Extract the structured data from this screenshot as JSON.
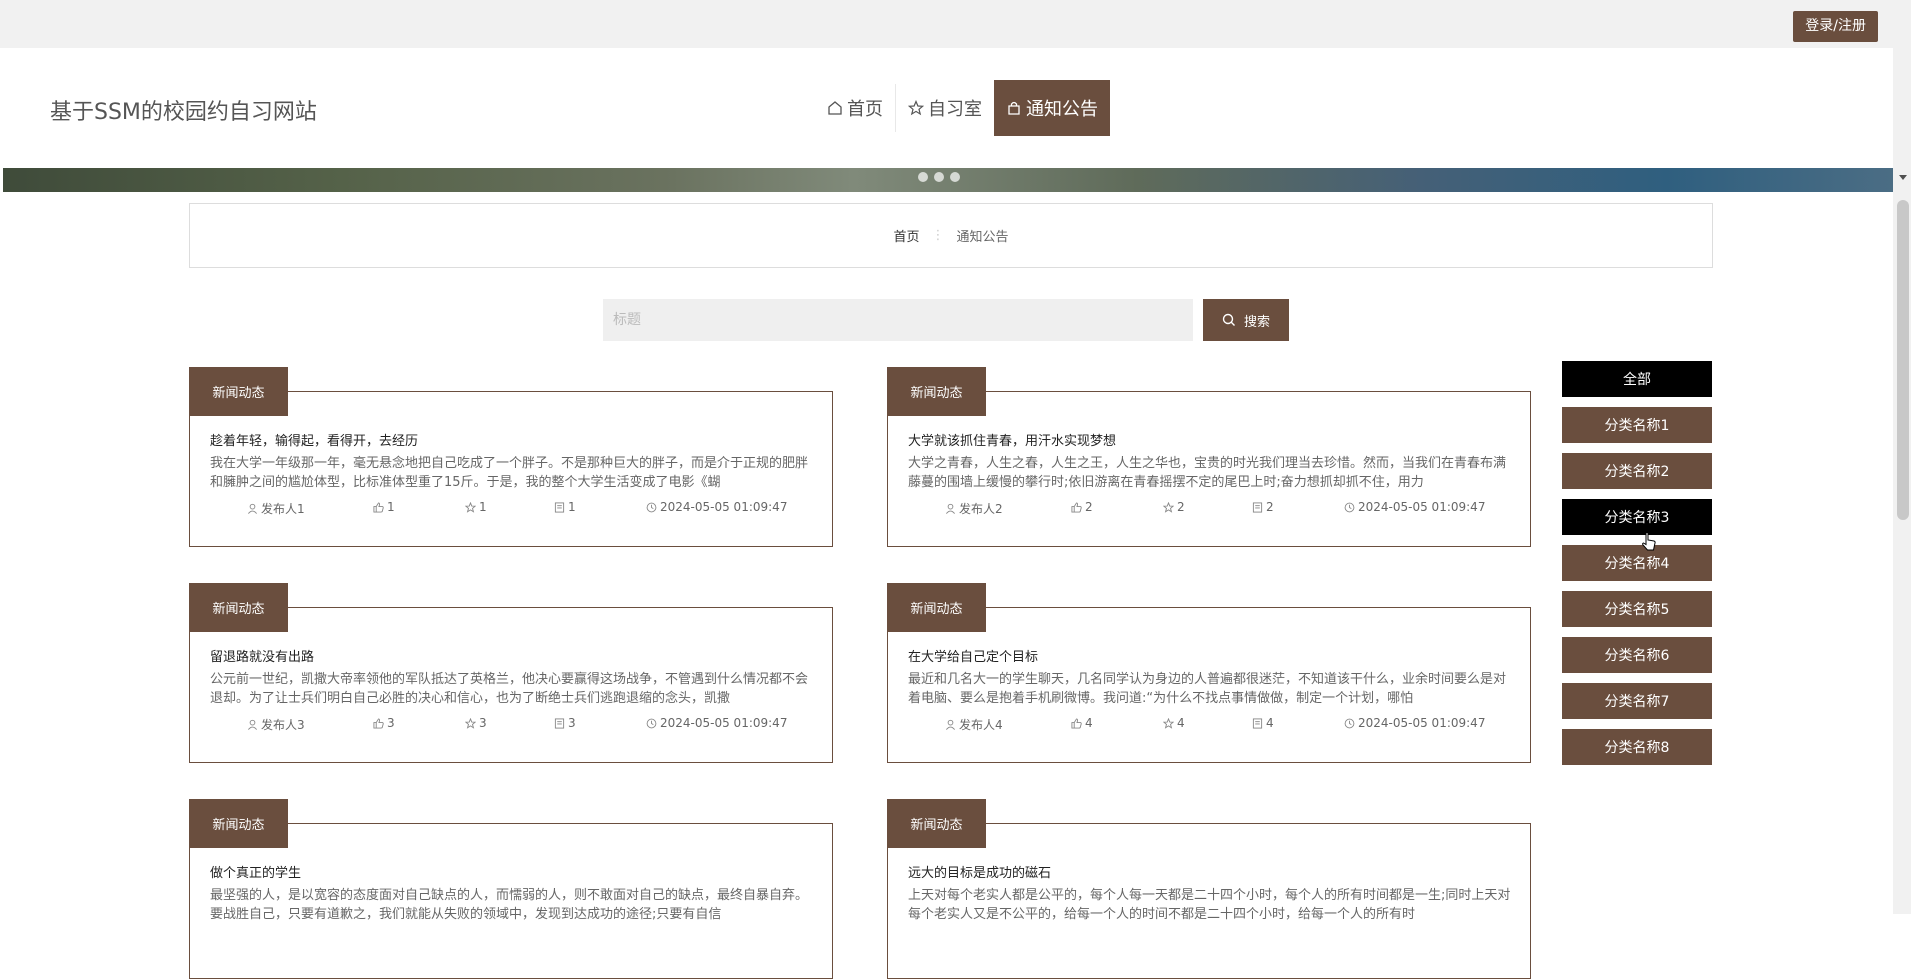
{
  "topbar": {
    "login_label": "登录/注册"
  },
  "header": {
    "site_title": "基于SSM的校园约自习网站",
    "nav": [
      {
        "label": "首页",
        "icon": "home-icon"
      },
      {
        "label": "自习室",
        "icon": "star-icon"
      },
      {
        "label": "通知公告",
        "icon": "bag-icon",
        "active": true
      }
    ]
  },
  "breadcrumb": {
    "home": "首页",
    "separator": "⋮",
    "current": "通知公告"
  },
  "search": {
    "placeholder": "标题",
    "button_label": "搜索"
  },
  "articles": [
    {
      "tag": "新闻动态",
      "title": "趁着年轻，输得起，看得开，去经历",
      "excerpt": "我在大学一年级那一年，毫无悬念地把自己吃成了一个胖子。不是那种巨大的胖子，而是介于正规的肥胖和臃肿之间的尴尬体型，比标准体型重了15斤。于是，我的整个大学生活变成了电影《蝴",
      "author": "发布人1",
      "likes": "1",
      "favorites": "1",
      "comments": "1",
      "time": "2024-05-05 01:09:47"
    },
    {
      "tag": "新闻动态",
      "title": "大学就该抓住青春，用汗水实现梦想",
      "excerpt": "大学之青春，人生之春，人生之王，人生之华也，宝贵的时光我们理当去珍惜。然而，当我们在青春布满藤蔓的围墙上缓慢的攀行时;依旧游离在青春摇摆不定的尾巴上时;奋力想抓却抓不住，用力",
      "author": "发布人2",
      "likes": "2",
      "favorites": "2",
      "comments": "2",
      "time": "2024-05-05 01:09:47"
    },
    {
      "tag": "新闻动态",
      "title": "留退路就没有出路",
      "excerpt": "公元前一世纪，凯撒大帝率领他的军队抵达了英格兰，他决心要赢得这场战争，不管遇到什么情况都不会退却。为了让士兵们明白自己必胜的决心和信心，也为了断绝士兵们逃跑退缩的念头，凯撒",
      "author": "发布人3",
      "likes": "3",
      "favorites": "3",
      "comments": "3",
      "time": "2024-05-05 01:09:47"
    },
    {
      "tag": "新闻动态",
      "title": "在大学给自己定个目标",
      "excerpt": "最近和几名大一的学生聊天，几名同学认为身边的人普遍都很迷茫，不知道该干什么，业余时间要么是对着电脑、要么是抱着手机刷微博。我问道:“为什么不找点事情做做，制定一个计划，哪怕",
      "author": "发布人4",
      "likes": "4",
      "favorites": "4",
      "comments": "4",
      "time": "2024-05-05 01:09:47"
    },
    {
      "tag": "新闻动态",
      "title": "做个真正的学生",
      "excerpt": "最坚强的人，是以宽容的态度面对自己缺点的人，而懦弱的人，则不敢面对自己的缺点，最终自暴自弃。要战胜自己，只要有道歉之，我们就能从失败的领域中，发现到达成功的途径;只要有自信",
      "author": "",
      "likes": "",
      "favorites": "",
      "comments": "",
      "time": ""
    },
    {
      "tag": "新闻动态",
      "title": "远大的目标是成功的磁石",
      "excerpt": "上天对每个老实人都是公平的，每个人每一天都是二十四个小时，每个人的所有时间都是一生;同时上天对每个老实人又是不公平的，给每一个人的时间不都是二十四个小时，给每一个人的所有时",
      "author": "",
      "likes": "",
      "favorites": "",
      "comments": "",
      "time": ""
    }
  ],
  "categories": [
    {
      "label": "全部",
      "style": "black"
    },
    {
      "label": "分类名称1"
    },
    {
      "label": "分类名称2"
    },
    {
      "label": "分类名称3",
      "style": "black"
    },
    {
      "label": "分类名称4"
    },
    {
      "label": "分类名称5"
    },
    {
      "label": "分类名称6"
    },
    {
      "label": "分类名称7"
    },
    {
      "label": "分类名称8"
    }
  ],
  "colors": {
    "accent": "#6a4e3e",
    "highlight": "#000000",
    "topbar": "#f1f1f1"
  }
}
